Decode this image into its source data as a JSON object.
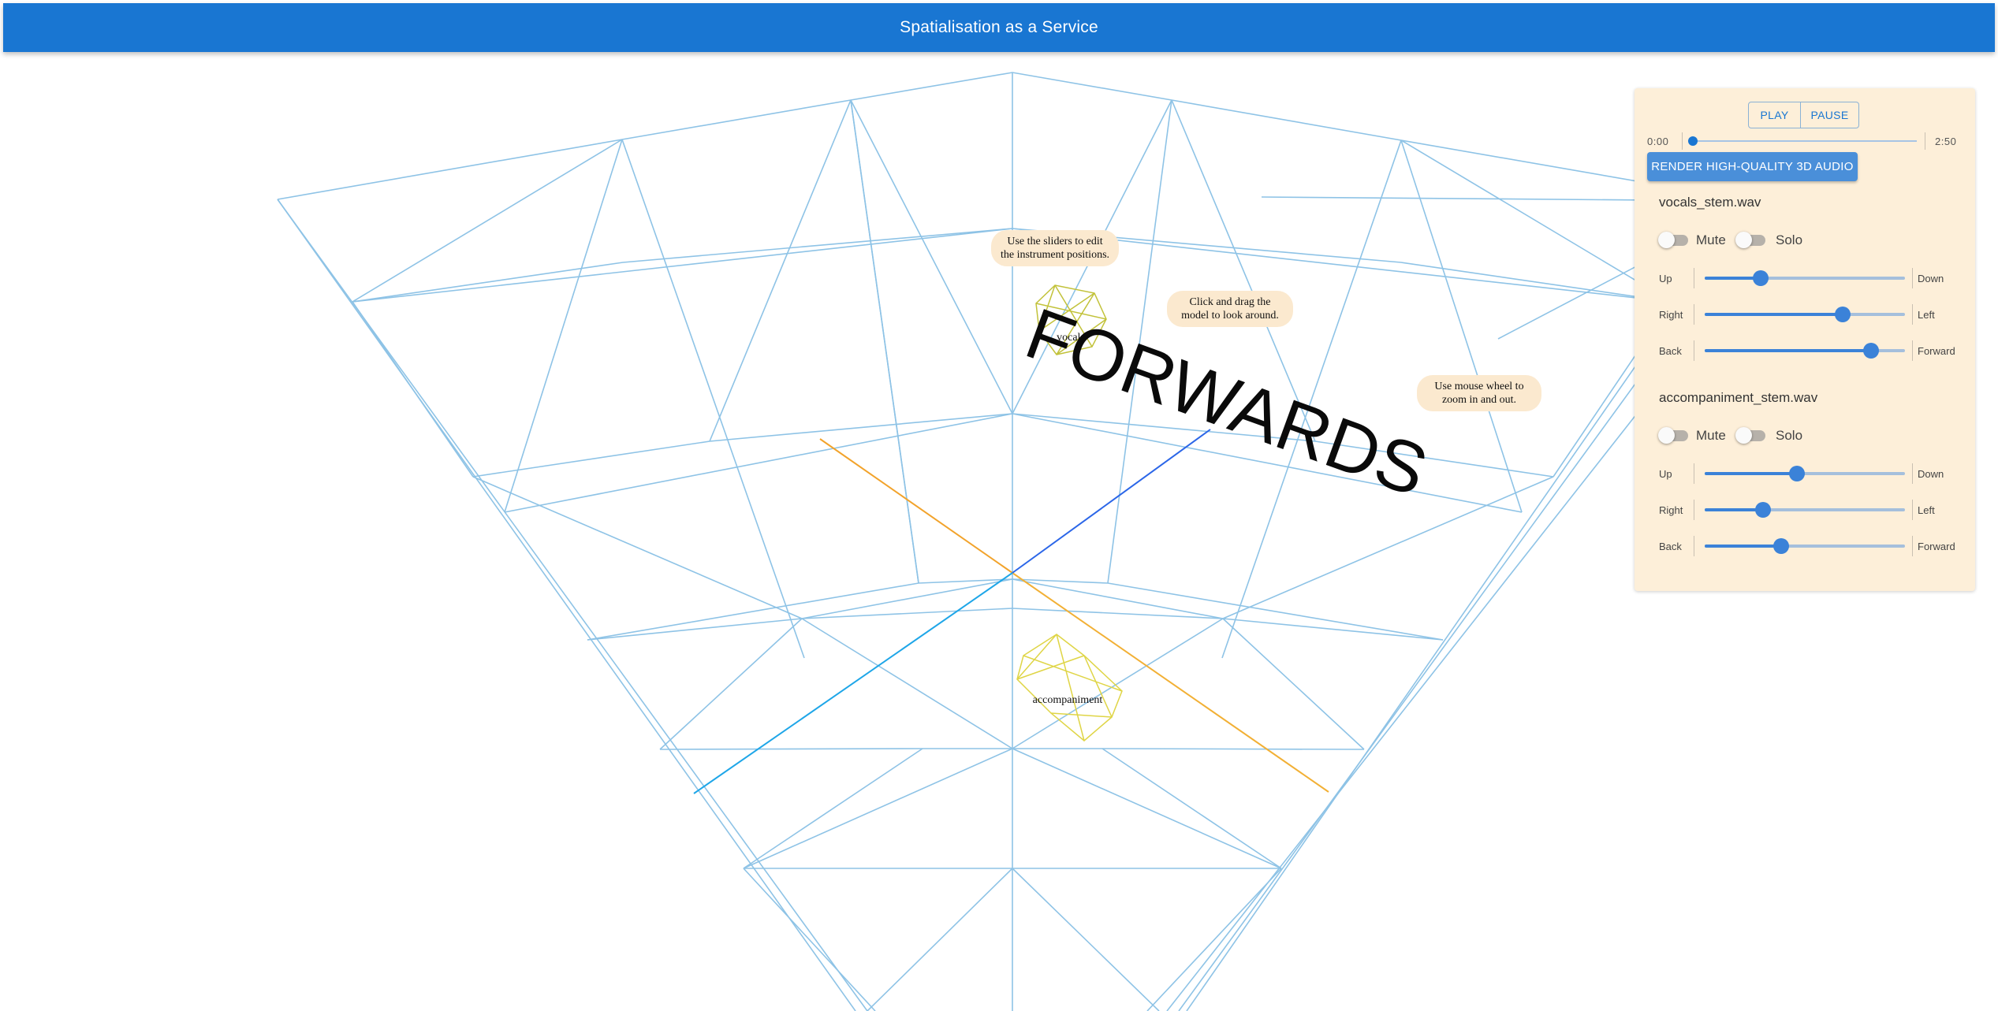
{
  "app": {
    "title": "Spatialisation as a Service"
  },
  "scene": {
    "forward_label": "FORWARDS",
    "instruments": [
      {
        "label": "vocals"
      },
      {
        "label": "accompaniment"
      }
    ],
    "hints": [
      {
        "line1": "Use the sliders to edit",
        "line2": "the instrument positions."
      },
      {
        "line1": "Click and drag the",
        "line2": "model to look around."
      },
      {
        "line1": "Use mouse wheel to",
        "line2": "zoom in and out."
      }
    ],
    "colors": {
      "grid": "#8ec3e6",
      "instrument": "#c8c43a",
      "axis_x": "#ff8c00",
      "axis_z": "#1e6be0"
    }
  },
  "panel": {
    "play_label": "PLAY",
    "pause_label": "PAUSE",
    "time_current": "0:00",
    "time_total": "2:50",
    "playback_progress": 0.0,
    "render_label": "RENDER HIGH-QUALITY 3D AUDIO",
    "stems": [
      {
        "name": "vocals_stem.wav",
        "mute_label": "Mute",
        "mute": false,
        "solo_label": "Solo",
        "solo": false,
        "sliders": [
          {
            "left": "Up",
            "right": "Down",
            "value": 0.28
          },
          {
            "left": "Right",
            "right": "Left",
            "value": 0.69
          },
          {
            "left": "Back",
            "right": "Forward",
            "value": 0.83
          }
        ]
      },
      {
        "name": "accompaniment_stem.wav",
        "mute_label": "Mute",
        "mute": false,
        "solo_label": "Solo",
        "solo": false,
        "sliders": [
          {
            "left": "Up",
            "right": "Down",
            "value": 0.46
          },
          {
            "left": "Right",
            "right": "Left",
            "value": 0.29
          },
          {
            "left": "Back",
            "right": "Forward",
            "value": 0.38
          }
        ]
      }
    ]
  }
}
